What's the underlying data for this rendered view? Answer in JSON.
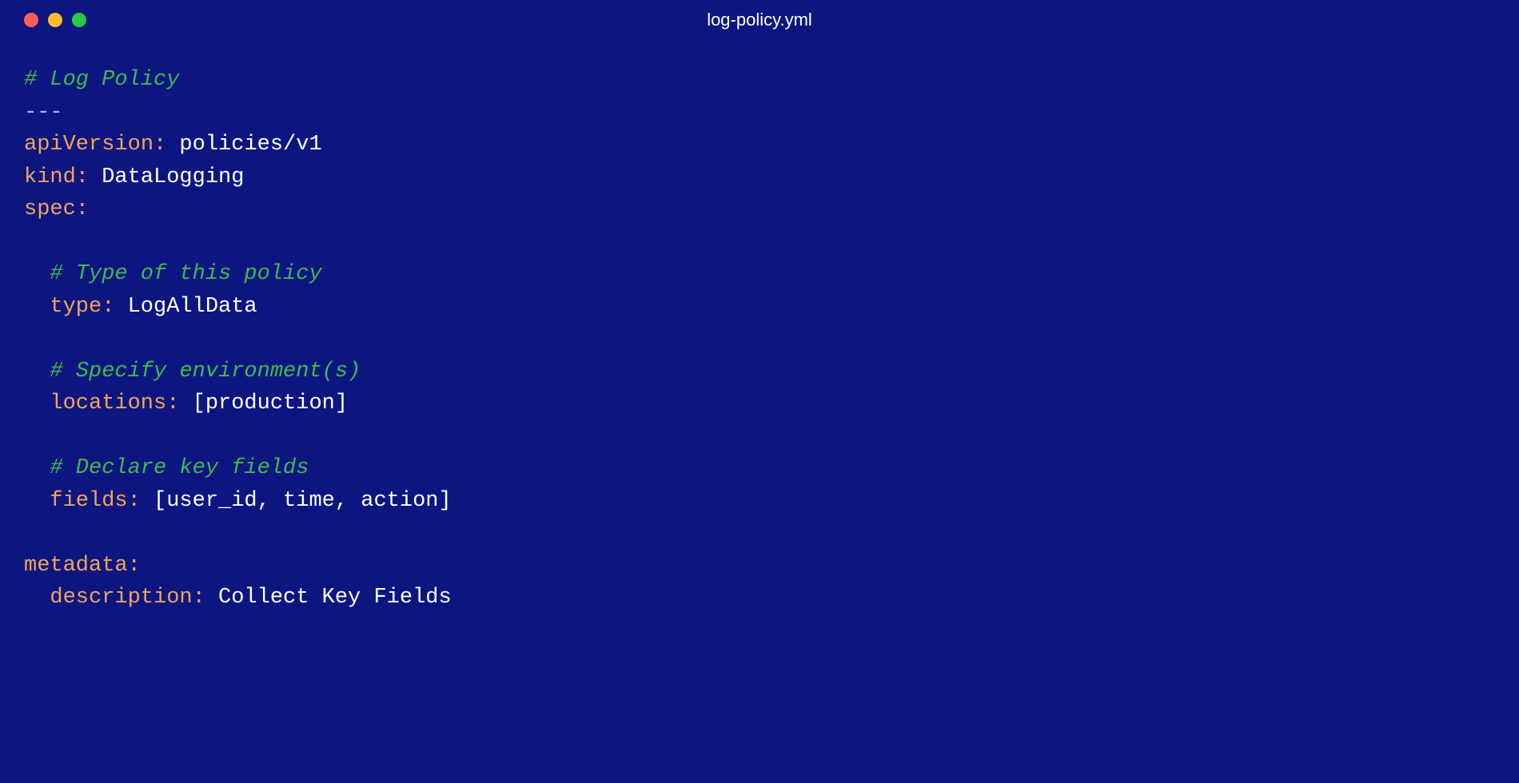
{
  "window": {
    "title": "log-policy.yml"
  },
  "code": {
    "comment_title": "# Log Policy",
    "doc_separator": "---",
    "apiVersion_key": "apiVersion:",
    "apiVersion_val": " policies/v1",
    "kind_key": "kind:",
    "kind_val": " DataLogging",
    "spec_key": "spec:",
    "comment_type": "# Type of this policy",
    "type_key": "type:",
    "type_val": " LogAllData",
    "comment_env": "# Specify environment(s)",
    "locations_key": "locations:",
    "locations_open": " [",
    "locations_val": "production",
    "locations_close": "]",
    "comment_fields": "# Declare key fields",
    "fields_key": "fields:",
    "fields_open": " [",
    "fields_v1": "user_id",
    "fields_sep1": ", ",
    "fields_v2": "time",
    "fields_sep2": ", ",
    "fields_v3": "action",
    "fields_close": "]",
    "metadata_key": "metadata:",
    "description_key": "description:",
    "description_val": " Collect Key Fields"
  }
}
